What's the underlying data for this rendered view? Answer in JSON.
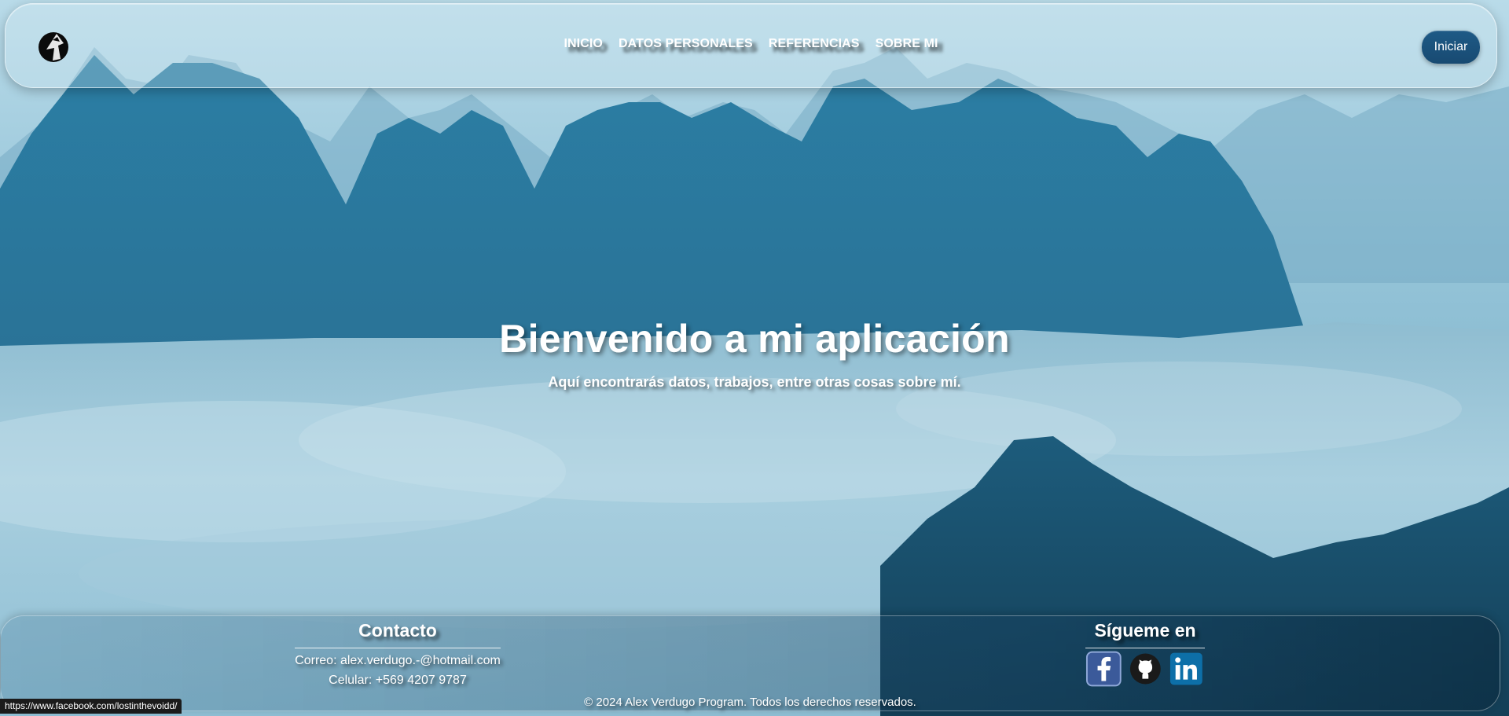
{
  "nav": {
    "items": [
      "INICIO",
      "DATOS PERSONALES",
      "REFERENCIAS",
      "SOBRE MI"
    ],
    "login_label": "Iniciar"
  },
  "hero": {
    "title": "Bienvenido a mi aplicación",
    "subtitle": "Aquí encontrarás datos, trabajos, entre otras cosas sobre mí."
  },
  "footer": {
    "contact_title": "Contacto",
    "email": "Correo: alex.verdugo.-@hotmail.com",
    "phone": "Celular: +569 4207 9787",
    "follow_title": "Sígueme en",
    "social": [
      "facebook-icon",
      "github-icon",
      "linkedin-icon"
    ],
    "copyright": "© 2024 Alex Verdugo Program. Todos los derechos reservados."
  },
  "status_bar": {
    "url": "https://www.facebook.com/lostinthevoidd/"
  },
  "colors": {
    "sky": "#b4d8e7",
    "mountain": "#2a7ea3",
    "mountain_dark": "#16506f",
    "button": "#1e5a86"
  }
}
